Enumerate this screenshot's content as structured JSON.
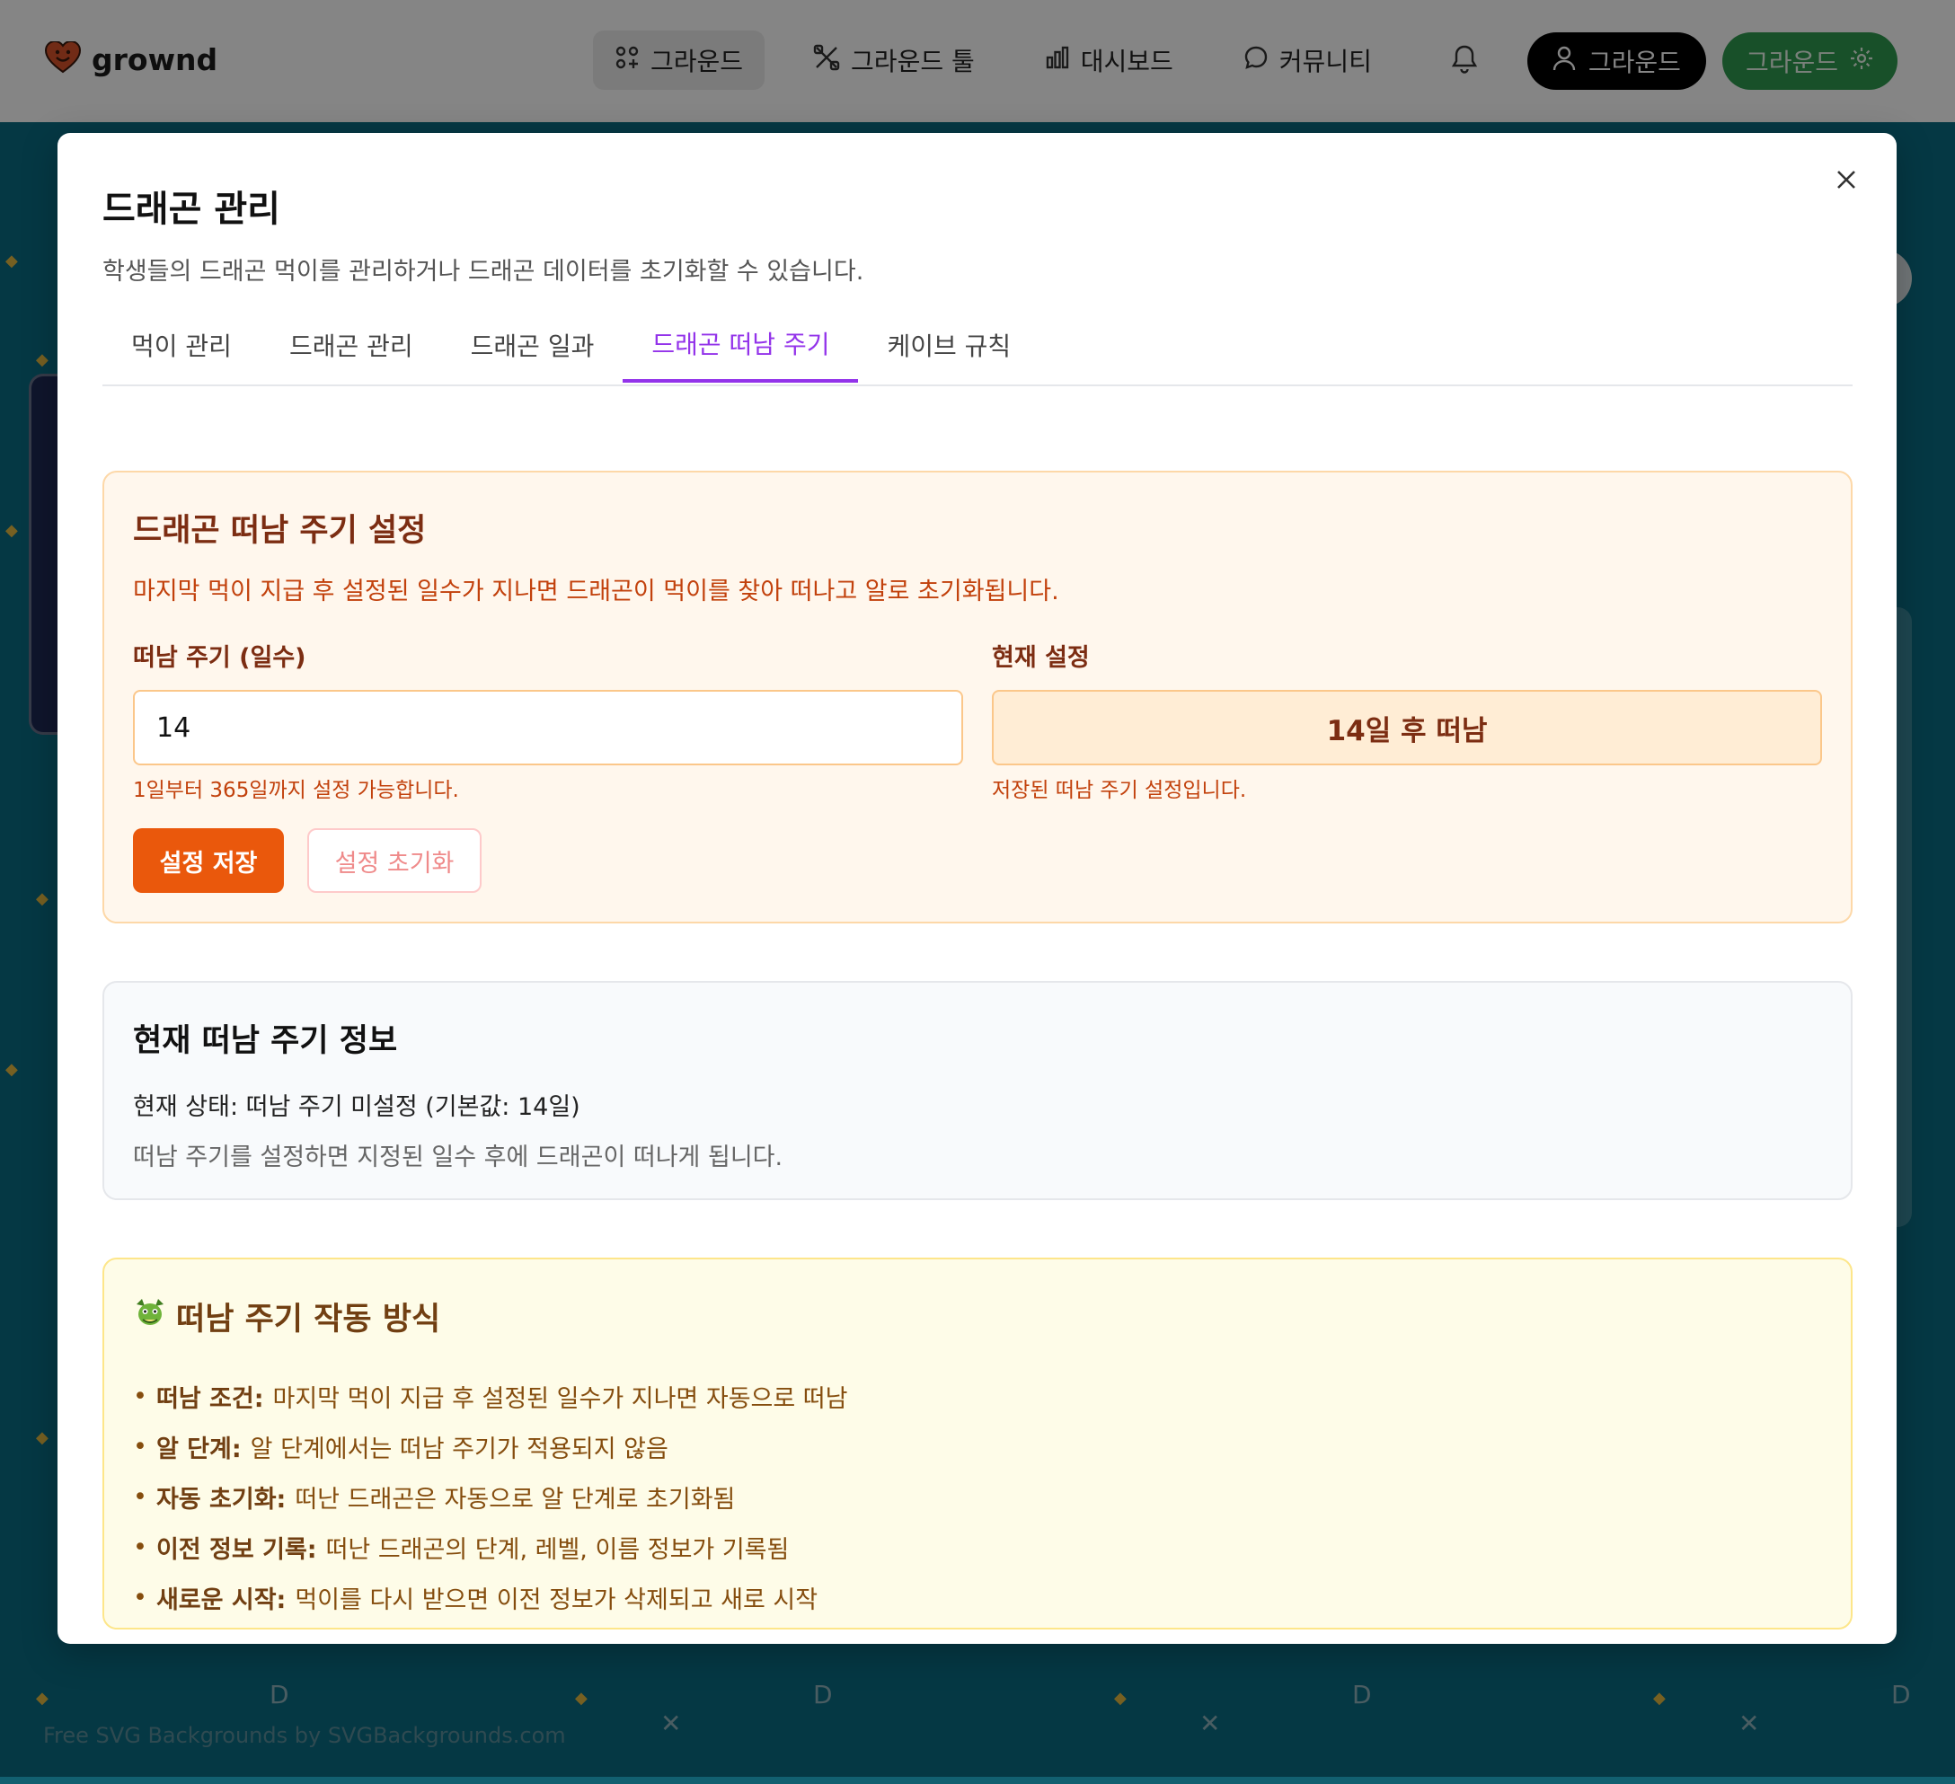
{
  "nav": {
    "brand": "grownd",
    "links": [
      "그라운드",
      "그라운드 툴",
      "대시보드",
      "커뮤니티"
    ],
    "user_button": "그라운드",
    "settings_button": "그라운드"
  },
  "watermark": "Free SVG Backgrounds by SVGBackgrounds.com",
  "modal": {
    "title": "드래곤 관리",
    "description": "학생들의 드래곤 먹이를 관리하거나 드래곤 데이터를 초기화할 수 있습니다.",
    "tabs": [
      "먹이 관리",
      "드래곤 관리",
      "드래곤 일과",
      "드래곤 떠남 주기",
      "케이브 규칙"
    ],
    "active_tab": "드래곤 떠남 주기"
  },
  "settings": {
    "title": "드래곤 떠남 주기 설정",
    "description": "마지막 먹이 지급 후 설정된 일수가 지나면 드래곤이 먹이를 찾아 떠나고 알로 초기화됩니다.",
    "input_label": "떠남 주기 (일수)",
    "input_value": "14",
    "input_hint": "1일부터 365일까지 설정 가능합니다.",
    "current_label": "현재 설정",
    "current_value": "14일 후 떠남",
    "current_hint": "저장된 떠남 주기 설정입니다.",
    "save_label": "설정 저장",
    "reset_label": "설정 초기화"
  },
  "info": {
    "title": "현재 떠남 주기 정보",
    "status": "현재 상태: 떠남 주기 미설정 (기본값: 14일)",
    "note": "떠남 주기를 설정하면 지정된 일수 후에 드래곤이 떠나게 됩니다."
  },
  "how": {
    "title": "떠남 주기 작동 방식",
    "rules": [
      {
        "label": "떠남 조건:",
        "text": "마지막 먹이 지급 후 설정된 일수가 지나면 자동으로 떠남"
      },
      {
        "label": "알 단계:",
        "text": "알 단계에서는 떠남 주기가 적용되지 않음"
      },
      {
        "label": "자동 초기화:",
        "text": "떠난 드래곤은 자동으로 알 단계로 초기화됨"
      },
      {
        "label": "이전 정보 기록:",
        "text": "떠난 드래곤의 단계, 레벨, 이름 정보가 기록됨"
      },
      {
        "label": "새로운 시작:",
        "text": "먹이를 다시 받으면 이전 정보가 삭제되고 새로 시작"
      }
    ]
  }
}
